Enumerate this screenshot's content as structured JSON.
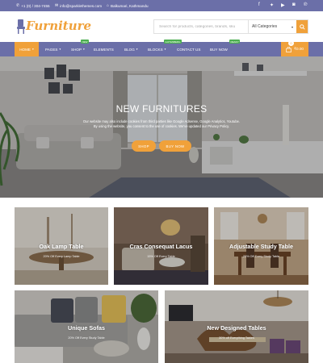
{
  "topbar": {
    "phone": "+1 (0) / 304-7455",
    "email": "info@sparklethemes.com",
    "location": "Balkumari, Kathmandu",
    "social": [
      "facebook-icon",
      "twitter-icon",
      "youtube-icon",
      "instagram-icon",
      "pinterest-icon"
    ]
  },
  "header": {
    "logo": "Furniture",
    "search_placeholder": "Search for products, categories, brands, sku",
    "category_selected": "All Categories"
  },
  "nav": {
    "items": [
      {
        "label": "HOME",
        "dropdown": true,
        "active": true
      },
      {
        "label": "PAGES",
        "dropdown": true
      },
      {
        "label": "SHOP",
        "dropdown": true,
        "badge": "NEW"
      },
      {
        "label": "ELEMENTS"
      },
      {
        "label": "BLOG",
        "dropdown": true
      },
      {
        "label": "BLOCKS",
        "dropdown": true,
        "badge": "GUTENBERG"
      },
      {
        "label": "CONTACT US"
      },
      {
        "label": "BUY NOW",
        "badge": "READY"
      }
    ],
    "cart_count": "0",
    "cart_total": "₹0.00"
  },
  "hero": {
    "title": "NEW FURNITURES",
    "text_line1": "Our website may also include cookies from third parties like Google Adsense, Google Analytics, Youtube.",
    "text_line2": "By using the website, you consent to the use of cookies. We've updated our Privacy Policy.",
    "button_shop": "SHOP",
    "button_buy": "BUY NOW"
  },
  "cards": [
    {
      "title": "Oak Lamp Table",
      "subtitle": "20% Off Every Lamp Table"
    },
    {
      "title": "Cras Consequat Lacus",
      "subtitle": "15% Off Every Table"
    },
    {
      "title": "Adjustable Study Table",
      "subtitle": "25% Off Every Study Table"
    },
    {
      "title": "Unique Sofas",
      "subtitle": "20% Off Every Study Table"
    },
    {
      "title": "New Designed Tables",
      "subtitle": "30% off Everything Tables"
    }
  ],
  "colors": {
    "brand": "#6b6fa8",
    "accent": "#f0a13a"
  }
}
